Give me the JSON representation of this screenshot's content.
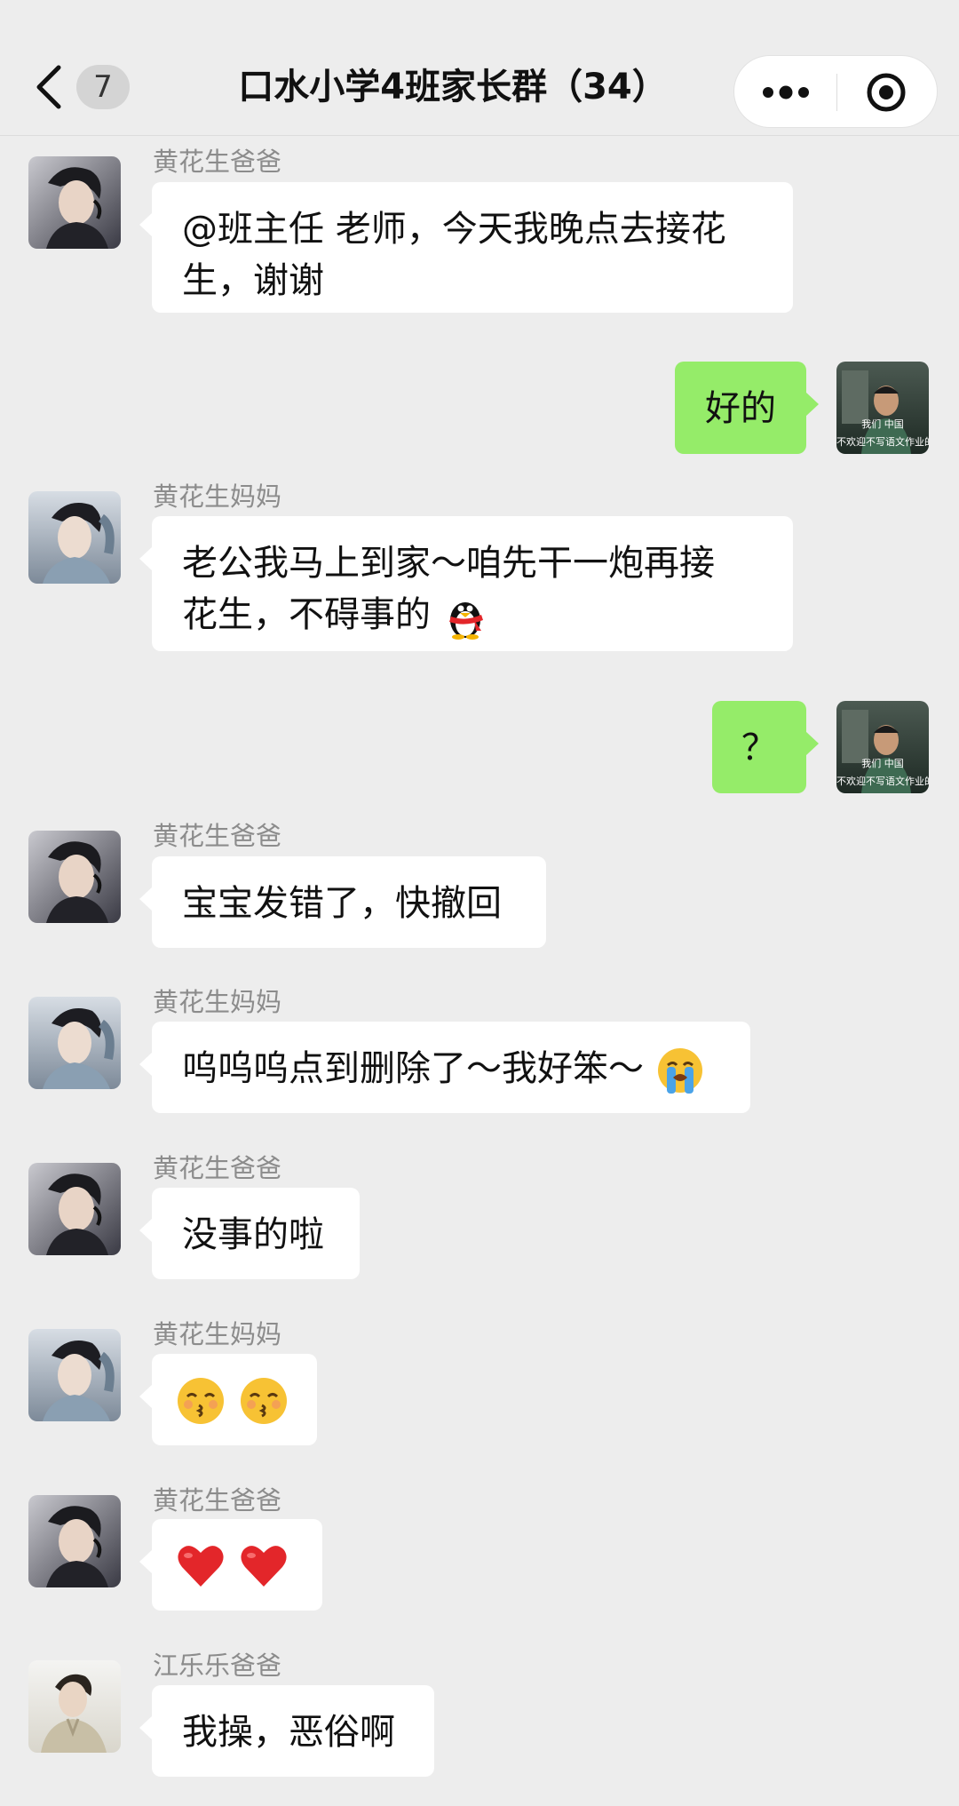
{
  "header": {
    "badge": "7",
    "title": "口水小学4班家长群（34）"
  },
  "avatars": {
    "self_caption_top": "我们 中国",
    "self_caption_bottom": "不欢迎不写语文作业的"
  },
  "messages": [
    {
      "sender": "黄花生爸爸",
      "text": "@班主任 老师，今天我晚点去接花生，谢谢",
      "line1": "@班主任 老师，今天我晚点去接花",
      "line2": "生，谢谢"
    },
    {
      "sender": "",
      "text": "好的",
      "from_self": true
    },
    {
      "sender": "黄花生妈妈",
      "line1": "老公我马上到家～咱先干一炮再接",
      "line2": "花生，不碍事的",
      "emoji": "penguin"
    },
    {
      "sender": "",
      "text": "？",
      "from_self": true
    },
    {
      "sender": "黄花生爸爸",
      "text": "宝宝发错了，快撤回"
    },
    {
      "sender": "黄花生妈妈",
      "text": "呜呜呜点到删除了～我好笨～",
      "emoji": "loudly-crying"
    },
    {
      "sender": "黄花生爸爸",
      "text": "没事的啦"
    },
    {
      "sender": "黄花生妈妈",
      "text": "",
      "emoji": "kissing-face x2"
    },
    {
      "sender": "黄花生爸爸",
      "text": "",
      "emoji": "red-heart x2"
    },
    {
      "sender": "江乐乐爸爸",
      "text": "我操，恶俗啊"
    }
  ],
  "colors": {
    "background": "#ededed",
    "self_bubble": "#95ec69",
    "other_bubble": "#ffffff",
    "sender_name": "#8c8c8c"
  }
}
